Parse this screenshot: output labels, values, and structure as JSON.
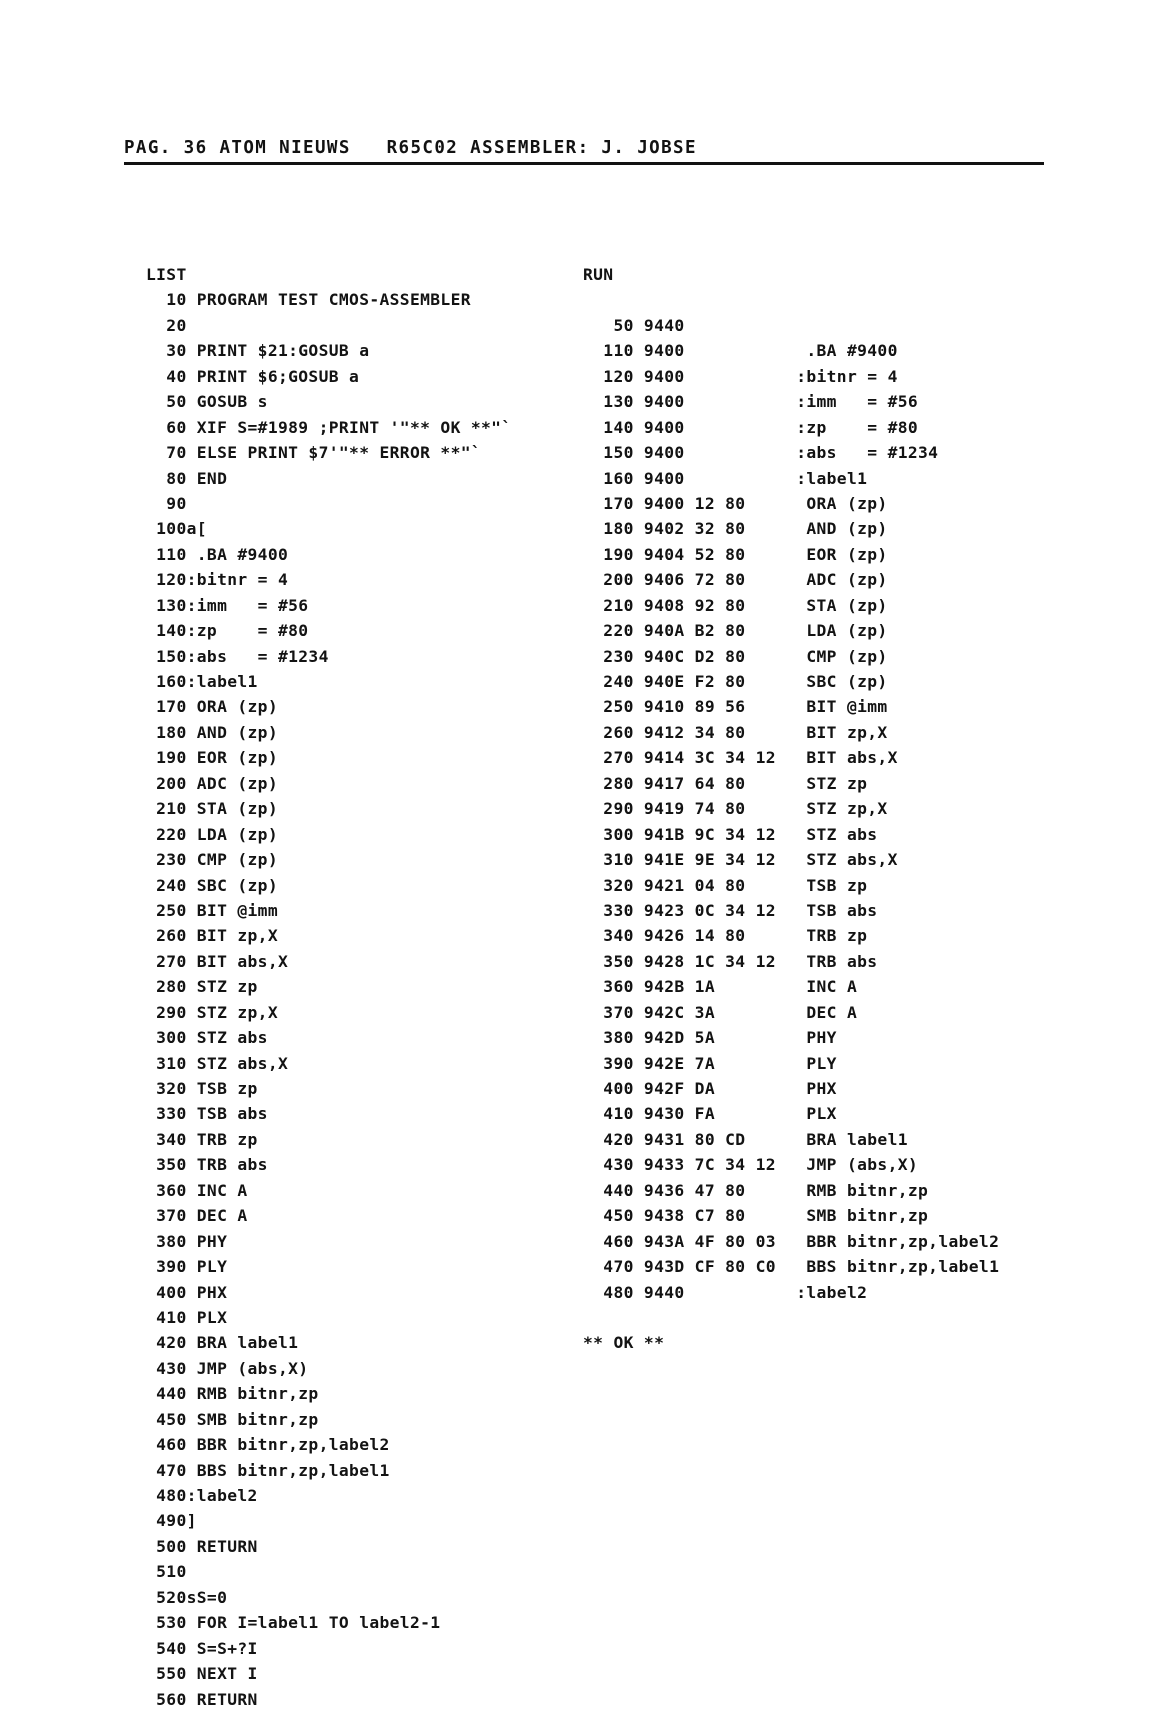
{
  "page": {
    "header": "PAG. 36 ATOM NIEUWS   R65C02 ASSEMBLER: J. JOBSE",
    "page_number": "36",
    "publication": "ATOM NIEUWS",
    "article_title": "R65C02 ASSEMBLER",
    "author": "J. JOBSE",
    "ink_color": "#131313",
    "paper_color": "#ffffff"
  },
  "left_listing": {
    "command": "LIST",
    "lines": [
      "LIST",
      "  10 PROGRAM TEST CMOS-ASSEMBLER",
      "  20",
      "  30 PRINT $21:GOSUB a",
      "  40 PRINT $6;GOSUB a",
      "  50 GOSUB s",
      "  60 XIF S=#1989 ;PRINT '\"** OK **\"`",
      "  70 ELSE PRINT $7'\"** ERROR **\"`",
      "  80 END",
      "  90",
      " 100a[",
      " 110 .BA #9400",
      " 120:bitnr = 4",
      " 130:imm   = #56",
      " 140:zp    = #80",
      " 150:abs   = #1234",
      " 160:label1",
      " 170 ORA (zp)",
      " 180 AND (zp)",
      " 190 EOR (zp)",
      " 200 ADC (zp)",
      " 210 STA (zp)",
      " 220 LDA (zp)",
      " 230 CMP (zp)",
      " 240 SBC (zp)",
      " 250 BIT @imm",
      " 260 BIT zp,X",
      " 270 BIT abs,X",
      " 280 STZ zp",
      " 290 STZ zp,X",
      " 300 STZ abs",
      " 310 STZ abs,X",
      " 320 TSB zp",
      " 330 TSB abs",
      " 340 TRB zp",
      " 350 TRB abs",
      " 360 INC A",
      " 370 DEC A",
      " 380 PHY",
      " 390 PLY",
      " 400 PHX",
      " 410 PLX",
      " 420 BRA label1",
      " 430 JMP (abs,X)",
      " 440 RMB bitnr,zp",
      " 450 SMB bitnr,zp",
      " 460 BBR bitnr,zp,label2",
      " 470 BBS bitnr,zp,label1",
      " 480:label2",
      " 490]",
      " 500 RETURN",
      " 510",
      " 520sS=0",
      " 530 FOR I=label1 TO label2-1",
      " 540 S=S+?I",
      " 550 NEXT I",
      " 560 RETURN"
    ]
  },
  "right_listing": {
    "command": "RUN",
    "result": "** OK **",
    "lines": [
      "RUN",
      "",
      "   50 9440",
      "  110 9400            .BA #9400",
      "  120 9400           :bitnr = 4",
      "  130 9400           :imm   = #56",
      "  140 9400           :zp    = #80",
      "  150 9400           :abs   = #1234",
      "  160 9400           :label1",
      "  170 9400 12 80      ORA (zp)",
      "  180 9402 32 80      AND (zp)",
      "  190 9404 52 80      EOR (zp)",
      "  200 9406 72 80      ADC (zp)",
      "  210 9408 92 80      STA (zp)",
      "  220 940A B2 80      LDA (zp)",
      "  230 940C D2 80      CMP (zp)",
      "  240 940E F2 80      SBC (zp)",
      "  250 9410 89 56      BIT @imm",
      "  260 9412 34 80      BIT zp,X",
      "  270 9414 3C 34 12   BIT abs,X",
      "  280 9417 64 80      STZ zp",
      "  290 9419 74 80      STZ zp,X",
      "  300 941B 9C 34 12   STZ abs",
      "  310 941E 9E 34 12   STZ abs,X",
      "  320 9421 04 80      TSB zp",
      "  330 9423 0C 34 12   TSB abs",
      "  340 9426 14 80      TRB zp",
      "  350 9428 1C 34 12   TRB abs",
      "  360 942B 1A         INC A",
      "  370 942C 3A         DEC A",
      "  380 942D 5A         PHY",
      "  390 942E 7A         PLY",
      "  400 942F DA         PHX",
      "  410 9430 FA         PLX",
      "  420 9431 80 CD      BRA label1",
      "  430 9433 7C 34 12   JMP (abs,X)",
      "  440 9436 47 80      RMB bitnr,zp",
      "  450 9438 C7 80      SMB bitnr,zp",
      "  460 943A 4F 80 03   BBR bitnr,zp,label2",
      "  470 943D CF 80 C0   BBS bitnr,zp,label1",
      "  480 9440           :label2",
      "",
      "** OK **"
    ]
  }
}
